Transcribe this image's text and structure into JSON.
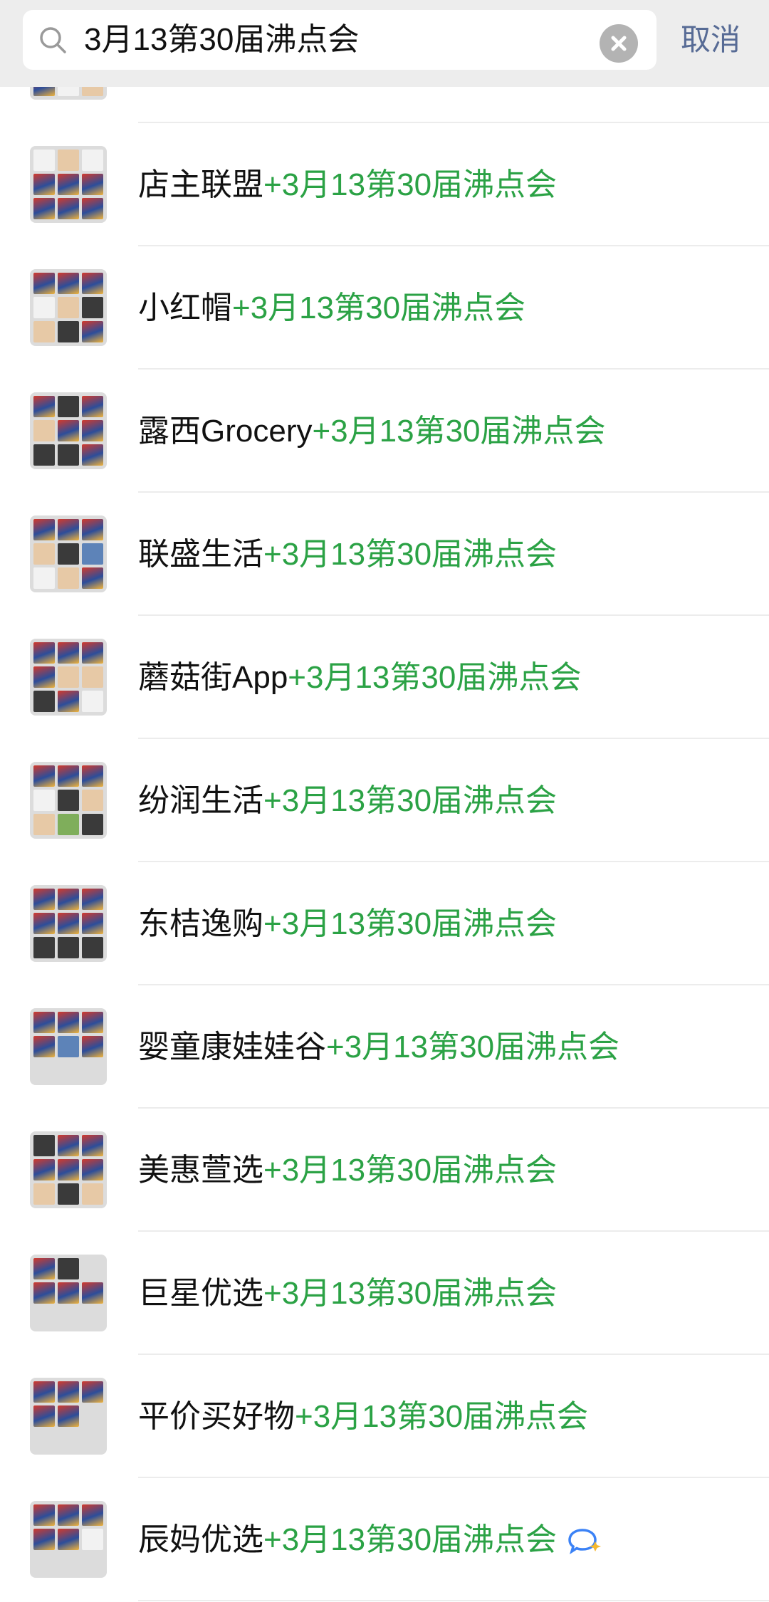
{
  "search": {
    "query": "3月13第30届沸点会",
    "cancel_label": "取消"
  },
  "results": [
    {
      "name": "店主联盟",
      "match": "+3月13第30届沸点会",
      "badge": false
    },
    {
      "name": "小红帽",
      "match": "+3月13第30届沸点会",
      "badge": false
    },
    {
      "name": "露西Grocery",
      "match": "+3月13第30届沸点会",
      "badge": false
    },
    {
      "name": "联盛生活",
      "match": "+3月13第30届沸点会",
      "badge": false
    },
    {
      "name": "蘑菇街App",
      "match": "+3月13第30届沸点会",
      "badge": false
    },
    {
      "name": "纷润生活",
      "match": "+3月13第30届沸点会",
      "badge": false
    },
    {
      "name": "东桔逸购",
      "match": "+3月13第30届沸点会",
      "badge": false
    },
    {
      "name": "婴童康娃娃谷",
      "match": "+3月13第30届沸点会",
      "badge": false
    },
    {
      "name": "美惠萱选",
      "match": "+3月13第30届沸点会",
      "badge": false
    },
    {
      "name": "巨星优选",
      "match": "+3月13第30届沸点会",
      "badge": false
    },
    {
      "name": "平价买好物",
      "match": "+3月13第30届沸点会",
      "badge": false
    },
    {
      "name": "辰妈优选",
      "match": "+3月13第30届沸点会",
      "badge": true
    }
  ],
  "colors": {
    "match_highlight": "#2ba245",
    "cancel": "#576b95",
    "header_bg": "#ededed"
  },
  "icons": {
    "search": "search-icon",
    "clear": "clear-icon",
    "badge": "chat-bubble-icon"
  }
}
